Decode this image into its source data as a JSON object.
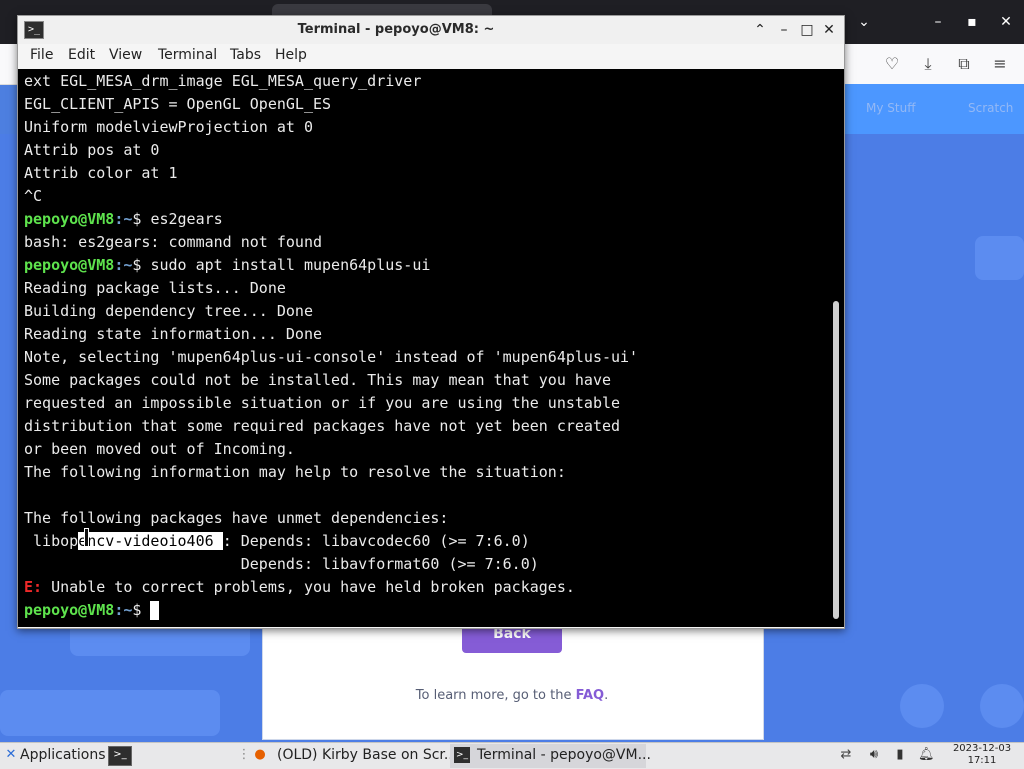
{
  "browser": {
    "site_links": [
      "My Stuff",
      "Scratch"
    ],
    "back_label": "Back",
    "faq_prefix": "To learn more, go to the ",
    "faq_link": "FAQ",
    "faq_suffix": "."
  },
  "terminal": {
    "title": "Terminal - pepoyo@VM8: ~",
    "app_icon": ">_",
    "menu": [
      "File",
      "Edit",
      "View",
      "Terminal",
      "Tabs",
      "Help"
    ],
    "prompt_user": "pepoyo@VM8",
    "prompt_path": ":~",
    "prompt_symbol": "$ ",
    "lines": [
      "ext EGL_MESA_drm_image EGL_MESA_query_driver",
      "EGL_CLIENT_APIS = OpenGL OpenGL_ES",
      "Uniform modelviewProjection at 0",
      "Attrib pos at 0",
      "Attrib color at 1",
      "^C",
      "es2gears",
      "bash: es2gears: command not found",
      "sudo apt install mupen64plus-ui",
      "Reading package lists... Done",
      "Building dependency tree... Done",
      "Reading state information... Done",
      "Note, selecting 'mupen64plus-ui-console' instead of 'mupen64plus-ui'",
      "Some packages could not be installed. This may mean that you have",
      "requested an impossible situation or if you are using the unstable",
      "distribution that some required packages have not yet been created",
      "or been moved out of Incoming.",
      "The following information may help to resolve the situation:",
      "",
      "The following packages have unmet dependencies:",
      " libop",
      "encv-videoio406 ",
      ": Depends: libavcodec60 (>= 7:6.0)",
      "                        Depends: libavformat60 (>= 7:6.0)",
      "E:",
      " Unable to correct problems, you have held broken packages."
    ]
  },
  "taskbar": {
    "applications_label": "Applications",
    "firefox_task": "(OLD) Kirby Base on Scr...",
    "terminal_task": "Terminal - pepoyo@VM...",
    "date": "2023-12-03",
    "time": "17:11"
  }
}
